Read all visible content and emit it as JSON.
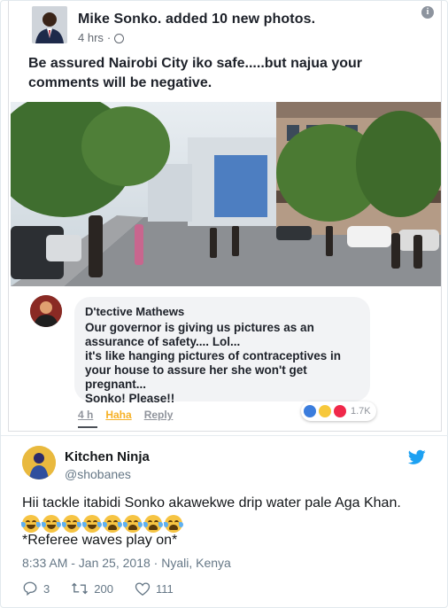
{
  "facebook_post": {
    "author_line": "Mike Sonko. added 10 new photos.",
    "time": "4 hrs",
    "time_separator": "·",
    "post_text": "Be assured Nairobi City iko safe.....but najua your comments will be negative.",
    "comment": {
      "author": "D'tective Mathews",
      "text": "Our governor is giving us pictures as an\nassurance of safety.... Lol...\nit's like hanging pictures of contraceptives  in\nyour house to assure her she won't get\npregnant...\nSonko! Please!!",
      "time": "4 h",
      "haha_label": "Haha",
      "reply_label": "Reply",
      "reaction_count": "1.7K"
    }
  },
  "tweet": {
    "display_name": "Kitchen Ninja",
    "handle": "@shobanes",
    "text": "Hii tackle itabidi Sonko akawekwe drip water pale Aga Khan.",
    "emojis": [
      "joy",
      "joy",
      "joy",
      "joy",
      "sob",
      "sob",
      "sob",
      "sob"
    ],
    "text2": "*Referee waves play on*",
    "timestamp": "8:33 AM - Jan 25, 2018 · Nyali, Kenya",
    "reply_count": "3",
    "retweet_count": "200",
    "like_count": "111"
  },
  "colors": {
    "twitter_blue": "#1da1f2",
    "fb_link_grey": "#90949c",
    "haha_yellow": "#f7b125"
  }
}
